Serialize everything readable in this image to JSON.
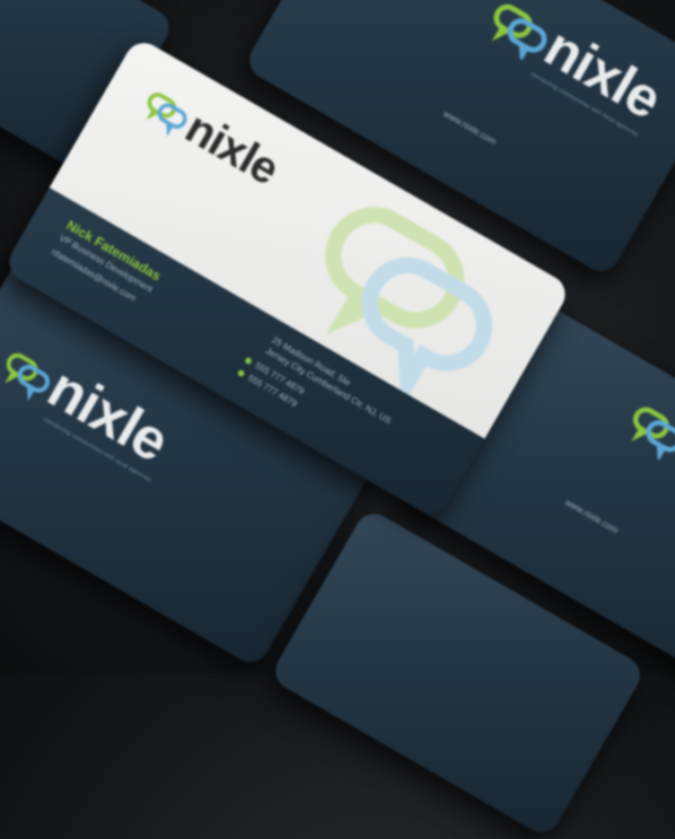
{
  "brand": {
    "name": "nixle",
    "green": "#8cc63f",
    "blue": "#5ba7d6",
    "card_dark": "#243746",
    "card_light": "#efefed"
  },
  "front_card": {
    "person_name": "Nick Fatemiadas",
    "role": "VP Business Development",
    "email": "nfatemiadas@nixle.com",
    "address_line1": "25 Madison Road, Ste",
    "address_line2": "Jersey City Cumberland Ctr, NJ, US",
    "phone1": "555 777 4879",
    "phone2": "555 777 4879"
  },
  "back_cards": {
    "tagline": "connecting communities with local agencies",
    "url": "www.nixle.com"
  }
}
